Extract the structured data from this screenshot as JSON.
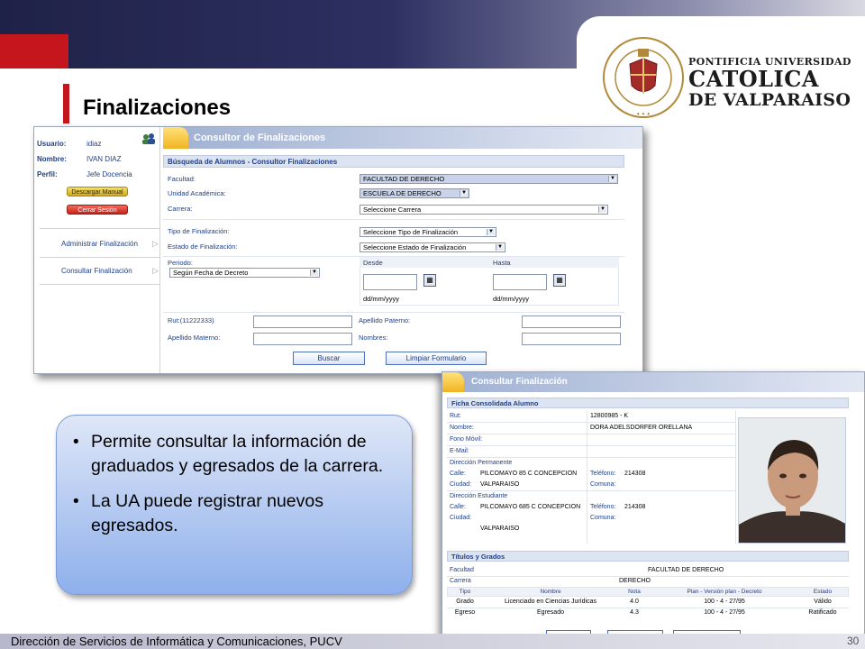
{
  "slide": {
    "title": "Finalizaciones",
    "footer": "Dirección de Servicios de Informática y Comunicaciones, PUCV",
    "page_number": "30",
    "accent_color": "#c4161c",
    "band_color": "#2d3061"
  },
  "logo": {
    "line1": "PONTIFICIA UNIVERSIDAD",
    "line2": "CATOLICA",
    "line3": "DE VALPARAISO",
    "seal_text": "PONTIFICIA UNIVERSIDAD CATOLICA DE VALPARAISO"
  },
  "consultor": {
    "header": "Consultor de Finalizaciones",
    "sidebar": {
      "usuario_label": "Usuario:",
      "usuario": "idiaz",
      "nombre_label": "Nombre:",
      "nombre": "IVAN DIAZ",
      "perfil_label": "Perfil:",
      "perfil": "Jefe Docencia",
      "descargar": "Descargar Manual",
      "cerrar": "Cerrar Sesión",
      "menu": [
        "Administrar Finalización",
        "Consultar Finalización"
      ]
    },
    "section": "Búsqueda de Alumnos - Consultor Finalizaciones",
    "facultad_label": "Facultad:",
    "facultad": "FACULTAD DE DERECHO",
    "unidad_label": "Unidad Académica:",
    "unidad": "ESCUELA DE DERECHO",
    "carrera_label": "Carrera:",
    "carrera": "Seleccione Carrera",
    "tipo_label": "Tipo de Finalización:",
    "tipo": "Seleccione Tipo de Finalización",
    "estado_label": "Estado de Finalización:",
    "estado": "Seleccione Estado de Finalización",
    "periodo_label": "Periodo:",
    "periodo": "Según Fecha de Decreto",
    "desde": "Desde",
    "hasta": "Hasta",
    "date_fmt": "dd/mm/yyyy",
    "rut_label": "Rut:(11222333)",
    "paterno_label": "Apellido Paterno:",
    "materno_label": "Apellido Materno:",
    "nombres_label": "Nombres:",
    "buscar": "Buscar",
    "limpiar": "Limpiar Formulario"
  },
  "ficha": {
    "header": "Consultar Finalización",
    "section": "Ficha Consolidada Alumno",
    "rut_label": "Rut:",
    "rut": "12800985 - K",
    "nombre_label": "Nombre:",
    "nombre": "DORA ADELSDORFER ORELLANA",
    "fono_label": "Fono Móvil:",
    "email_label": "E-Mail:",
    "dir_perm": "Dirección Permanente",
    "calle_label": "Calle:",
    "calle": "PILCOMAYO 85 C CONCEPCION",
    "telefono_label": "Teléfono:",
    "telefono": "214308",
    "ciudad_label": "Ciudad:",
    "ciudad": "VALPARAISO",
    "comuna_label": "Comuna:",
    "dir_est": "Dirección Estudiante",
    "calle2": "PILCOMAYO 685 C CONCEPCION",
    "telefono2": "214308",
    "ciudad2": "VALPARAISO",
    "titulos_section": "Títulos y Grados",
    "facultad_label": "Facultad",
    "facultad": "FACULTAD DE DERECHO",
    "carrera_label": "Carrera",
    "carrera": "DERECHO",
    "table_headers": [
      "Tipo",
      "Nombre",
      "Nota",
      "Plan - Versión plan - Decreto",
      "Estado"
    ],
    "rows": [
      [
        "Grado",
        "Licenciado en Ciencias Jurídicas",
        "4.0",
        "100 - 4 - 27/95",
        "Válido"
      ],
      [
        "Egreso",
        "Egresado",
        "4.3",
        "100 - 4 - 27/95",
        "Ratificado"
      ]
    ],
    "buttons": [
      "Imprimir",
      "Volver al Menu",
      "Volver al Listado"
    ]
  },
  "callout": {
    "bullets": [
      "Permite consultar la información de graduados y egresados de la carrera.",
      "La UA puede registrar nuevos egresados."
    ]
  }
}
